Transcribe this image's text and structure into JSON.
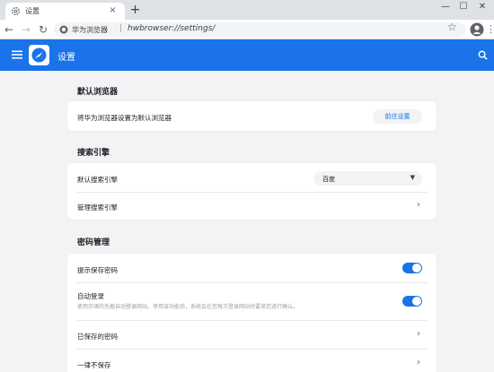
{
  "tab": {
    "title": "设置",
    "close_glyph": "×"
  },
  "newtab": {
    "glyph": "+"
  },
  "window_controls": {
    "minimize": "—",
    "maximize": "☐",
    "close": "✕"
  },
  "toolbar": {
    "back_glyph": "←",
    "forward_glyph": "→",
    "reload_glyph": "↻",
    "site_name": "华为浏览器",
    "separator": "|",
    "url": "hwbrowser://settings/",
    "star_glyph": "☆",
    "menu_glyph": "⋮"
  },
  "header": {
    "title": "设置",
    "accent_color": "#1a73e8"
  },
  "sections": {
    "default_browser": {
      "title": "默认浏览器",
      "label": "将华为浏览器设置为默认浏览器",
      "button": "前往设置"
    },
    "search_engine": {
      "title": "搜索引擎",
      "default_label": "默认搜索引擎",
      "default_value": "百度",
      "manage_label": "管理搜索引擎",
      "caret": "▼",
      "chevron": "›"
    },
    "passwords": {
      "title": "密码管理",
      "offer_save_label": "提示保存密码",
      "offer_save_on": true,
      "auto_signin_label": "自动登录",
      "auto_signin_desc": "使用存储的凭据自动登录网站。停用该功能后，系统会在您每次登录网站时要求您进行确认。",
      "auto_signin_on": true,
      "saved_label": "已保存的密码",
      "never_label": "一律不保存",
      "chevron": "›"
    }
  },
  "icons": {
    "tab_favicon": "gear-icon",
    "omnibox": "site-info-icon",
    "header_menu": "hamburger-icon",
    "header_logo": "browser-logo-icon",
    "header_search": "search-icon",
    "avatar": "account-icon"
  }
}
